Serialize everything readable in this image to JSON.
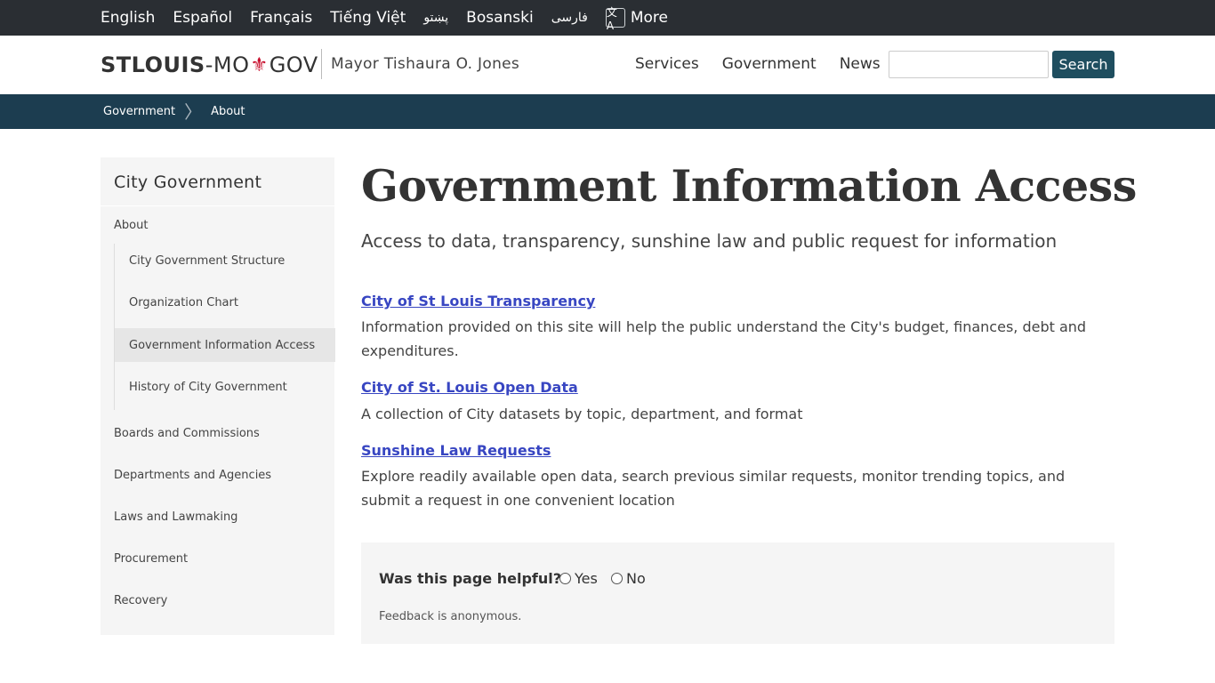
{
  "languages": {
    "items": [
      "English",
      "Español",
      "Français",
      "Tiếng Việt",
      "پښتو",
      "Bosanski",
      "فارسی"
    ],
    "more_label": "More",
    "more_icon": "translate-icon"
  },
  "header": {
    "logo_bold": "STLOUIS",
    "logo_mid": "-MO",
    "logo_end": "GOV",
    "logo_symbol": "⚜",
    "mayor": "Mayor Tishaura O. Jones",
    "nav": [
      "Services",
      "Government",
      "News"
    ],
    "search_placeholder": "",
    "search_value": "",
    "search_button": "Search",
    "brand_color": "#1c3d50",
    "accent_red": "#c8102e"
  },
  "breadcrumb": [
    "Government",
    "About"
  ],
  "sidebar": {
    "title": "City Government",
    "items": [
      {
        "label": "About"
      },
      {
        "label": "Boards and Commissions"
      },
      {
        "label": "Departments and Agencies"
      },
      {
        "label": "Laws and Lawmaking"
      },
      {
        "label": "Procurement"
      },
      {
        "label": "Recovery"
      }
    ],
    "sub_items": [
      {
        "label": "City Government Structure",
        "active": false
      },
      {
        "label": "Organization Chart",
        "active": false
      },
      {
        "label": "Government Information Access",
        "active": true
      },
      {
        "label": "History of City Government",
        "active": false
      }
    ]
  },
  "main": {
    "title": "Government Information Access",
    "subtitle": "Access to data, transparency, sunshine law and public request for information",
    "resources": [
      {
        "link": "City of St Louis Transparency",
        "desc": "Information provided on this site will help the public understand the City's budget, finances, debt and expenditures."
      },
      {
        "link": "City of St. Louis Open Data",
        "desc": "A collection of City datasets by topic, department, and format"
      },
      {
        "link": "Sunshine Law Requests",
        "desc": "Explore readily available open data, search previous similar requests, monitor trending topics, and submit a request in one convenient location"
      }
    ]
  },
  "feedback": {
    "question": "Was this page helpful?",
    "yes": "Yes",
    "no": "No",
    "note": "Feedback is anonymous."
  }
}
